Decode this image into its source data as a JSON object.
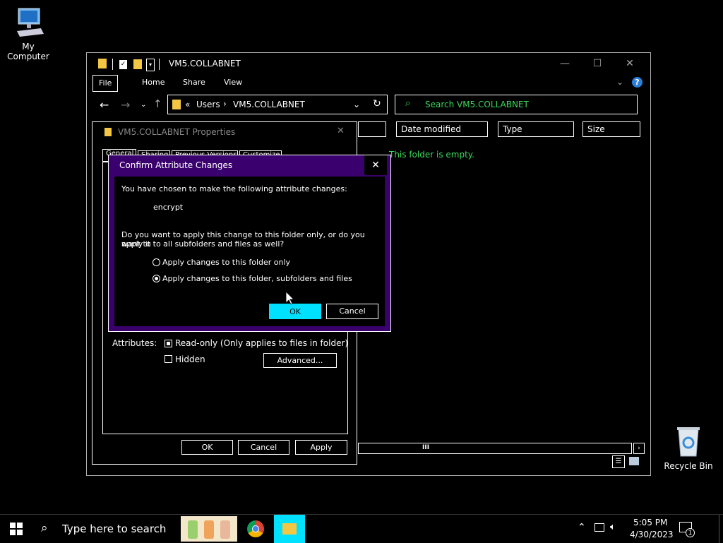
{
  "desktop": {
    "my_computer_label": "My Computer",
    "recycle_bin_label": "Recycle Bin"
  },
  "explorer": {
    "title": "VM5.COLLABNET",
    "ribbon": {
      "file": "File",
      "home": "Home",
      "share": "Share",
      "view": "View"
    },
    "address": {
      "prefix": "«",
      "crumb1": "Users",
      "sep": "›",
      "crumb2": "VM5.COLLABNET"
    },
    "search_placeholder": "Search VM5.COLLABNET",
    "columns": {
      "date": "Date modified",
      "type": "Type",
      "size": "Size"
    },
    "empty_text": "This folder is empty.",
    "scroll_glyph": "III"
  },
  "properties": {
    "title": "VM5.COLLABNET Properties",
    "tabs": [
      "General",
      "Sharing",
      "Previous Versions",
      "Customize"
    ],
    "attributes_label": "Attributes:",
    "readonly_label": "Read-only (Only applies to files in folder)",
    "hidden_label": "Hidden",
    "advanced_label": "Advanced...",
    "ok": "OK",
    "cancel": "Cancel",
    "apply": "Apply"
  },
  "confirm": {
    "title": "Confirm Attribute Changes",
    "intro": "You have chosen to make the following attribute changes:",
    "change": "encrypt",
    "question_line1": "Do you want to apply this change to this folder only, or do you want to",
    "question_line2": "apply it to all subfolders and files as well?",
    "option1": "Apply changes to this folder only",
    "option2": "Apply changes to this folder, subfolders and files",
    "selected_option": 2,
    "ok": "OK",
    "cancel": "Cancel",
    "accent": "#3a006e",
    "ok_bg": "#00e1ff"
  },
  "taskbar": {
    "search_placeholder": "Type here to search",
    "time": "5:05 PM",
    "date": "4/30/2023",
    "notification_count": "1"
  }
}
